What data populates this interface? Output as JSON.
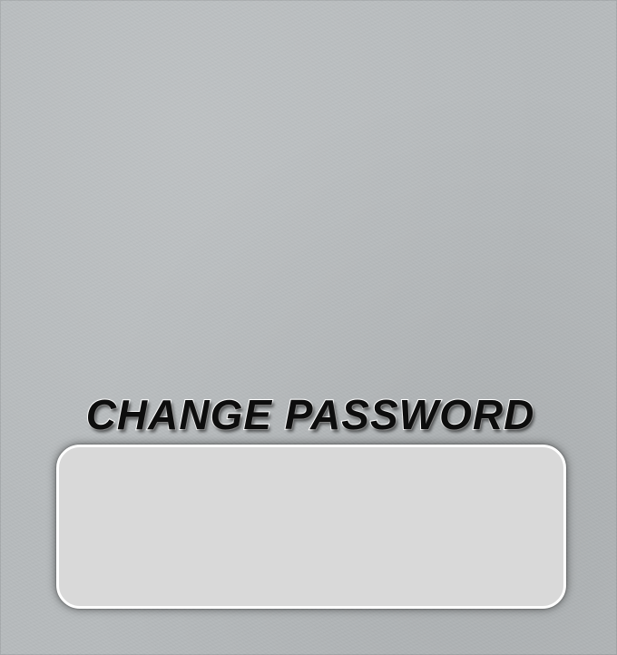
{
  "header": {
    "title": "CHANGE PASSWORD"
  },
  "colors": {
    "background": "#b7bbbd",
    "panel": "#d9d9d9",
    "panel_border": "#ffffff",
    "title_fill": "#0d0d0d",
    "title_outline": "#ffffff"
  }
}
